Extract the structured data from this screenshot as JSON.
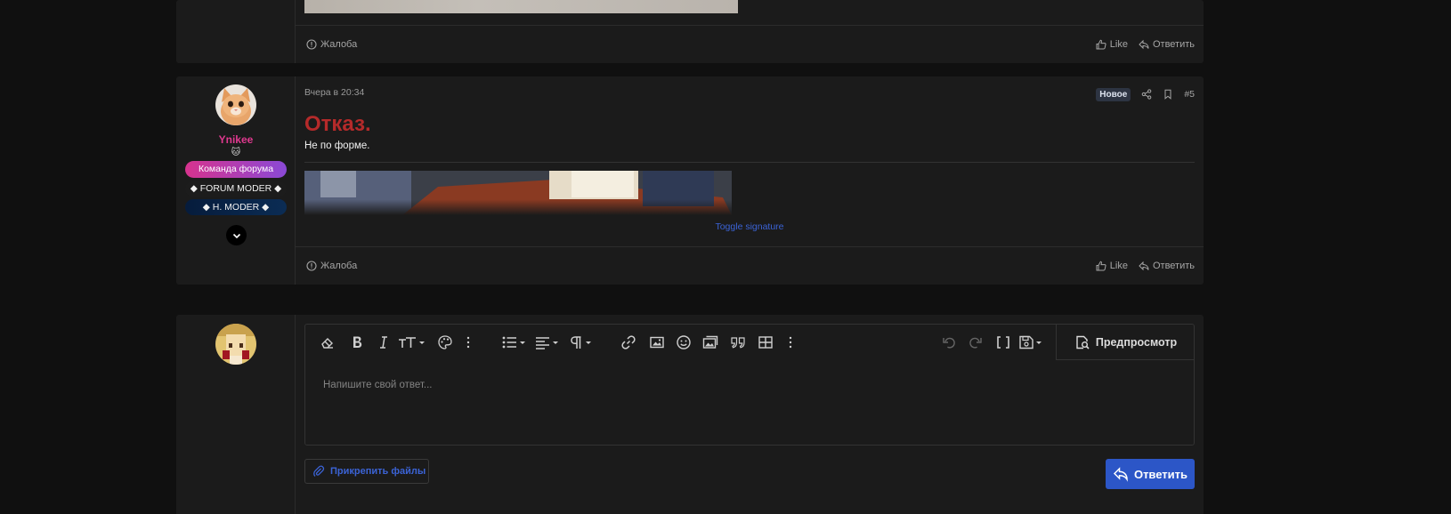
{
  "prev_post": {
    "report_label": "Жалоба",
    "like_label": "Like",
    "reply_label": "Ответить"
  },
  "post": {
    "time": "Вчера в 20:34",
    "badge_new": "Новое",
    "post_number": "#5",
    "user": {
      "name": "Ynikee",
      "emoji": "🐱",
      "banners": [
        "Команда форума",
        "◆ FORUM MODER ◆",
        "◆ H. MODER ◆"
      ]
    },
    "title": "Отказ.",
    "body": "Не по форме.",
    "toggle_signature": "Toggle signature",
    "report_label": "Жалоба",
    "like_label": "Like",
    "reply_label": "Ответить"
  },
  "reply_form": {
    "preview_label": "Предпросмотр",
    "placeholder": "Напишите свой ответ...",
    "attach_label": "Прикрепить файлы",
    "submit_label": "Ответить"
  },
  "colors": {
    "title_red": "#b52a2a",
    "username_pink": "#e0398f",
    "link_blue": "#3b63d6",
    "submit_blue": "#2c56c7"
  }
}
